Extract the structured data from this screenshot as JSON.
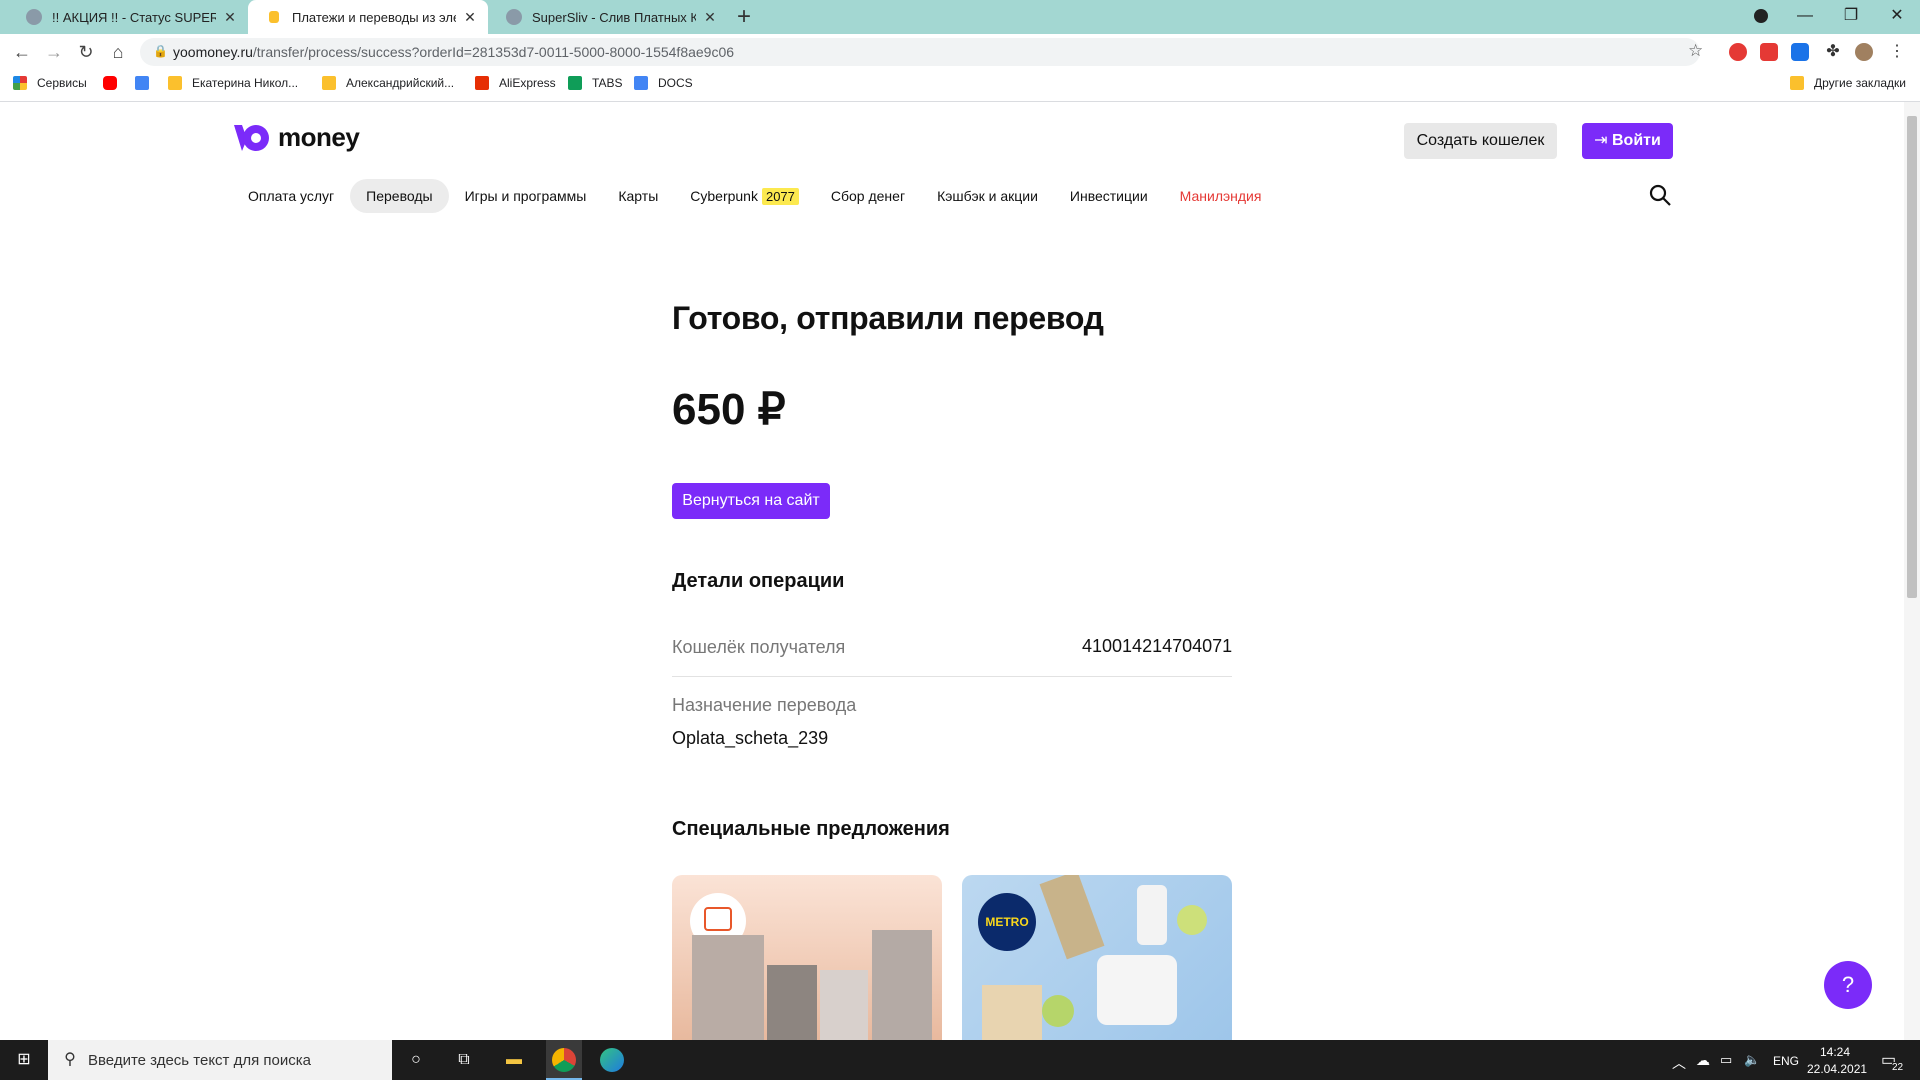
{
  "browser": {
    "tabs": [
      {
        "title": "!! АКЦИЯ !! - Статус SUPER VIP с",
        "active": false
      },
      {
        "title": "Платежи и переводы из электр",
        "active": true
      },
      {
        "title": "SuperSliv - Слив Платных Курсо",
        "active": false
      }
    ],
    "new_tab": "+",
    "url_host": "yoomoney.ru",
    "url_path": "/transfer/process/success?orderId=281353d7-0011-5000-8000-1554f8ae9c06",
    "bookmarks": [
      {
        "label": "Сервисы",
        "color": "#e53935"
      },
      {
        "label": "",
        "color": "#ff0000"
      },
      {
        "label": "",
        "color": "#4285f4"
      },
      {
        "label": "Екатерина Никол...",
        "color": "#fbc02d"
      },
      {
        "label": "Александрийский...",
        "color": "#fbc02d"
      },
      {
        "label": "AliExpress",
        "color": "#e62e04"
      },
      {
        "label": "TABS",
        "color": "#0f9d58"
      },
      {
        "label": "DOCS",
        "color": "#4285f4"
      }
    ],
    "other_bookmarks": "Другие закладки"
  },
  "site": {
    "logo_text": "money",
    "create_wallet": "Создать кошелек",
    "login": "Войти",
    "nav": [
      {
        "label": "Оплата услуг",
        "active": false,
        "red": false
      },
      {
        "label": "Переводы",
        "active": true,
        "red": false
      },
      {
        "label": "Игры и программы",
        "active": false,
        "red": false
      },
      {
        "label": "Карты",
        "active": false,
        "red": false
      },
      {
        "label": "Cyberpunk",
        "badge": "2077",
        "active": false,
        "red": false
      },
      {
        "label": "Сбор денег",
        "active": false,
        "red": false
      },
      {
        "label": "Кэшбэк и акции",
        "active": false,
        "red": false
      },
      {
        "label": "Инвестиции",
        "active": false,
        "red": false
      },
      {
        "label": "Манилэндия",
        "active": false,
        "red": true
      }
    ]
  },
  "main": {
    "title": "Готово, отправили перевод",
    "amount": "650 ₽",
    "back_button": "Вернуться на сайт",
    "details_title": "Детали операции",
    "recipient_label": "Кошелёк получателя",
    "recipient_value": "410014214704071",
    "purpose_label": "Назначение перевода",
    "purpose_value": "Oplata_scheta_239",
    "offers_title": "Специальные предложения",
    "offer2_badge": "METRO",
    "help": "?"
  },
  "taskbar": {
    "search_placeholder": "Введите здесь текст для поиска",
    "lang": "ENG",
    "time": "14:24",
    "date": "22.04.2021",
    "notifications": "22"
  }
}
